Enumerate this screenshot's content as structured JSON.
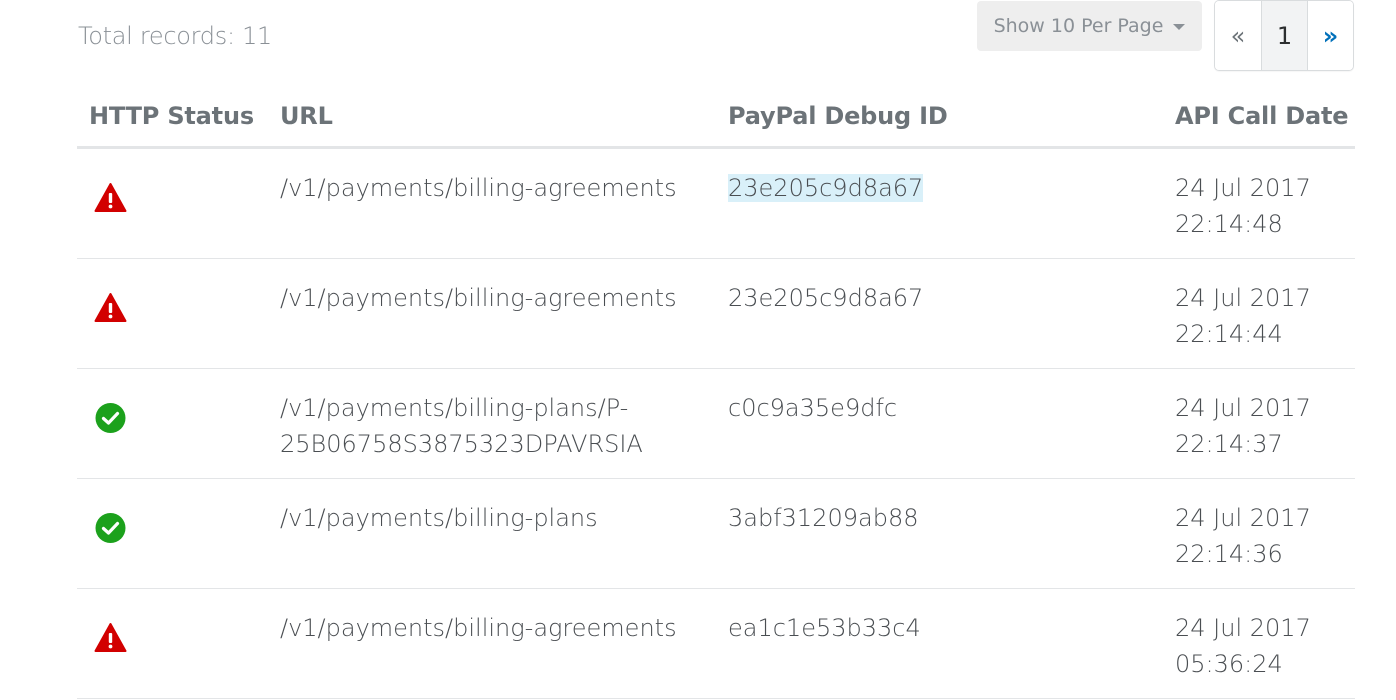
{
  "summary": {
    "total_records": "Total records: 11"
  },
  "per_page": {
    "label": "Show 10 Per Page"
  },
  "pagination": {
    "prev": "«",
    "current": "1",
    "next": "»"
  },
  "table": {
    "headers": [
      "HTTP Status",
      "URL",
      "PayPal Debug ID",
      "API Call Date"
    ],
    "rows": [
      {
        "status": "error",
        "status_icon": "warning-icon",
        "url": "/v1/payments/billing-agreements",
        "debug_id": "23e205c9d8a67",
        "date_line1": "24 Jul 2017",
        "date_line2": "22:14:48"
      },
      {
        "status": "error",
        "status_icon": "warning-icon",
        "url": "/v1/payments/billing-agreements",
        "debug_id": "23e205c9d8a67",
        "date_line1": "24 Jul 2017",
        "date_line2": "22:14:44"
      },
      {
        "status": "success",
        "status_icon": "check-circle-icon",
        "url": "/v1/payments/billing-plans/P-25B06758S3875323DPAVRSIA",
        "debug_id": "c0c9a35e9dfc",
        "date_line1": "24 Jul 2017",
        "date_line2": "22:14:37"
      },
      {
        "status": "success",
        "status_icon": "check-circle-icon",
        "url": "/v1/payments/billing-plans",
        "debug_id": "3abf31209ab88",
        "date_line1": "24 Jul 2017",
        "date_line2": "22:14:36"
      },
      {
        "status": "error",
        "status_icon": "warning-icon",
        "url": "/v1/payments/billing-agreements",
        "debug_id": "ea1c1e53b33c4",
        "date_line1": "24 Jul 2017",
        "date_line2": "05:36:24"
      }
    ]
  },
  "colors": {
    "error": "#d20000",
    "success": "#1ca11c",
    "link": "#0070ba",
    "highlight": "#d9f0f9"
  }
}
